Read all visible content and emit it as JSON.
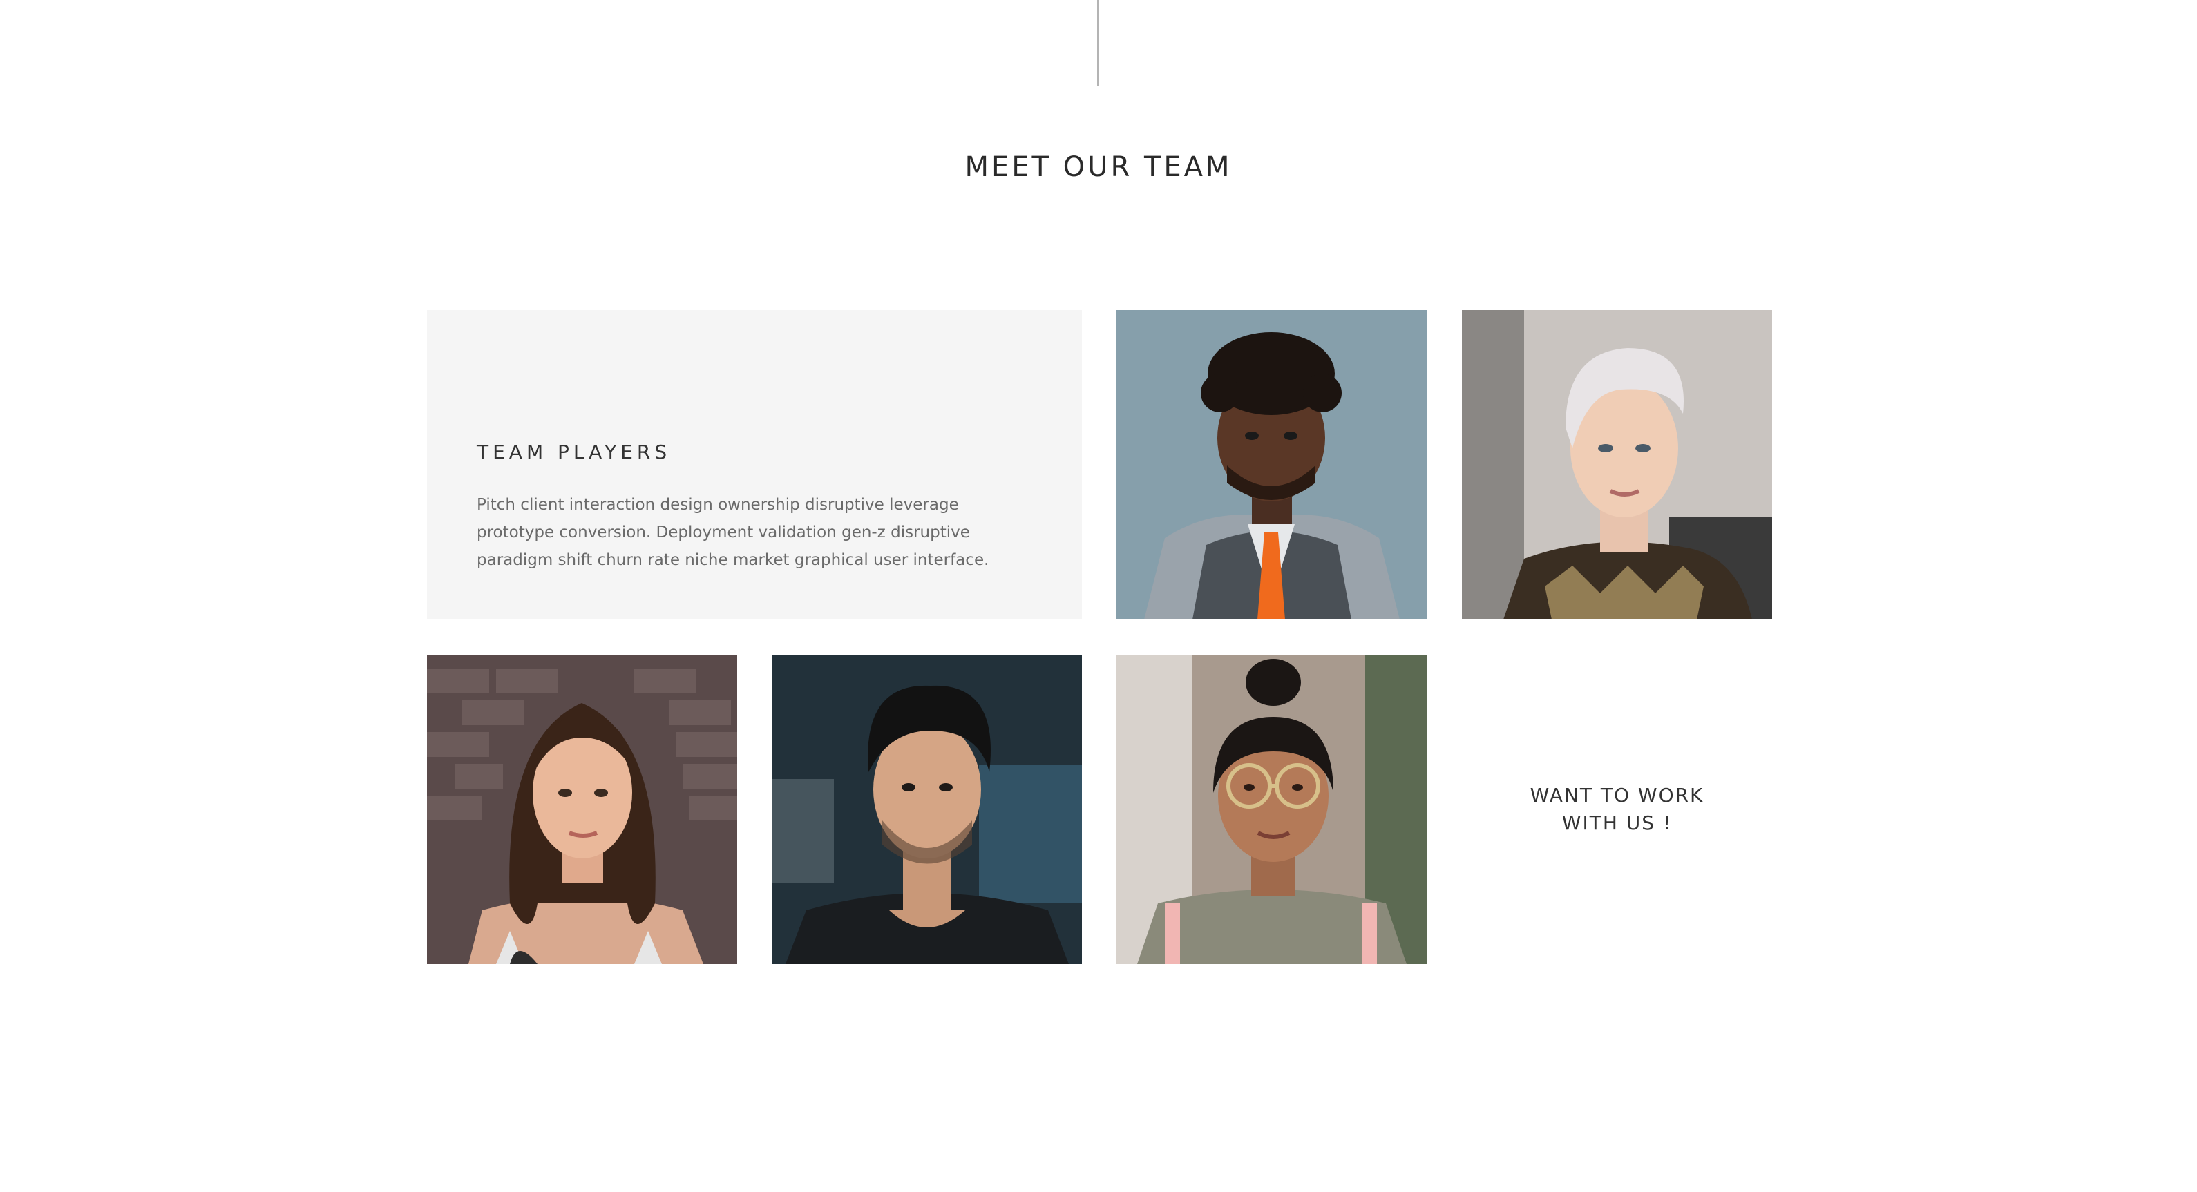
{
  "section": {
    "title": "MEET OUR TEAM"
  },
  "intro": {
    "heading": "TEAM PLAYERS",
    "body": "Pitch client interaction design ownership disruptive leverage prototype conversion. Deployment validation gen-z disruptive paradigm shift churn rate niche market graphical user interface."
  },
  "cta": {
    "label": "WANT TO WORK WITH US !"
  },
  "members": [
    {
      "photo": "portrait-man-vest-orange-tie"
    },
    {
      "photo": "portrait-woman-short-platinum-hair"
    },
    {
      "photo": "portrait-woman-long-brown-hair"
    },
    {
      "photo": "portrait-man-dark-curly-hair"
    },
    {
      "photo": "portrait-woman-glasses-hair-bun"
    }
  ],
  "colors": {
    "card_background": "#f5f5f5",
    "heading_text": "#333333",
    "body_text": "#6a6a6a",
    "divider": "#b4b4b4"
  }
}
